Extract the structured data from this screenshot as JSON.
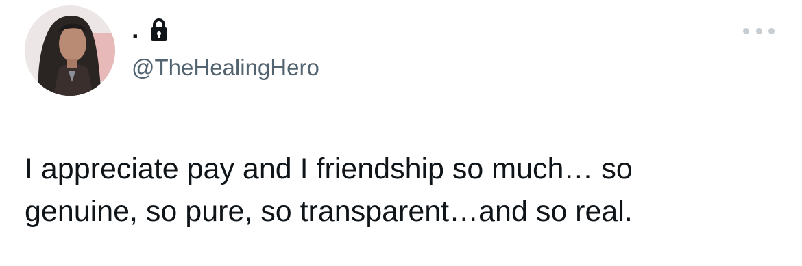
{
  "user": {
    "display_name": ".",
    "handle": "@TheHealingHero",
    "lock_icon": "lock-icon",
    "avatar_icon": "avatar"
  },
  "menu": {
    "more_icon": "more-horizontal-icon"
  },
  "tweet": {
    "text_line_1": "I appreciate pay and I friendship so much… so",
    "text_line_2": "genuine, so pure, so transparent…and so real."
  },
  "colors": {
    "text_primary": "#0f1419",
    "text_secondary": "#536471",
    "more_dots": "#c6cdd3"
  }
}
